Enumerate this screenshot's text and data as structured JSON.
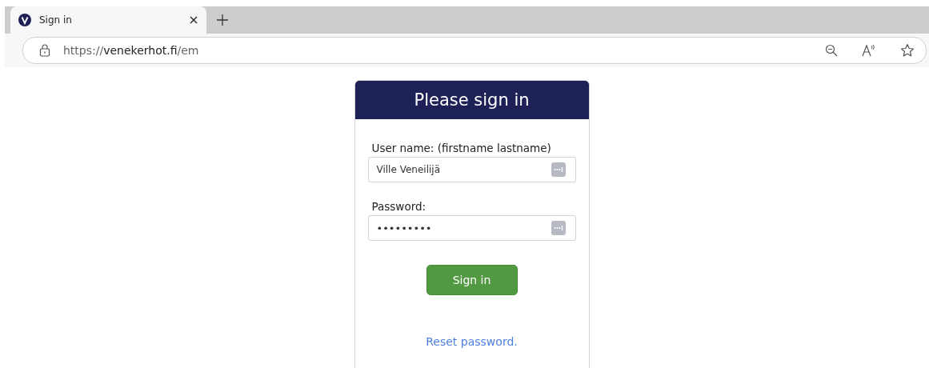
{
  "browser": {
    "tab": {
      "title": "Sign in",
      "selected": true
    },
    "address": {
      "scheme": "https://",
      "host": "venekerhot.fi",
      "path": "/em"
    }
  },
  "card": {
    "title": "Please sign in",
    "fields": [
      {
        "label": "User name: (firstname lastname)",
        "value": "Ville Veneilijä",
        "kind": "text"
      },
      {
        "label": "Password:",
        "value": "•••••••••",
        "kind": "password"
      }
    ],
    "button": "Sign in",
    "link": "Reset password."
  }
}
